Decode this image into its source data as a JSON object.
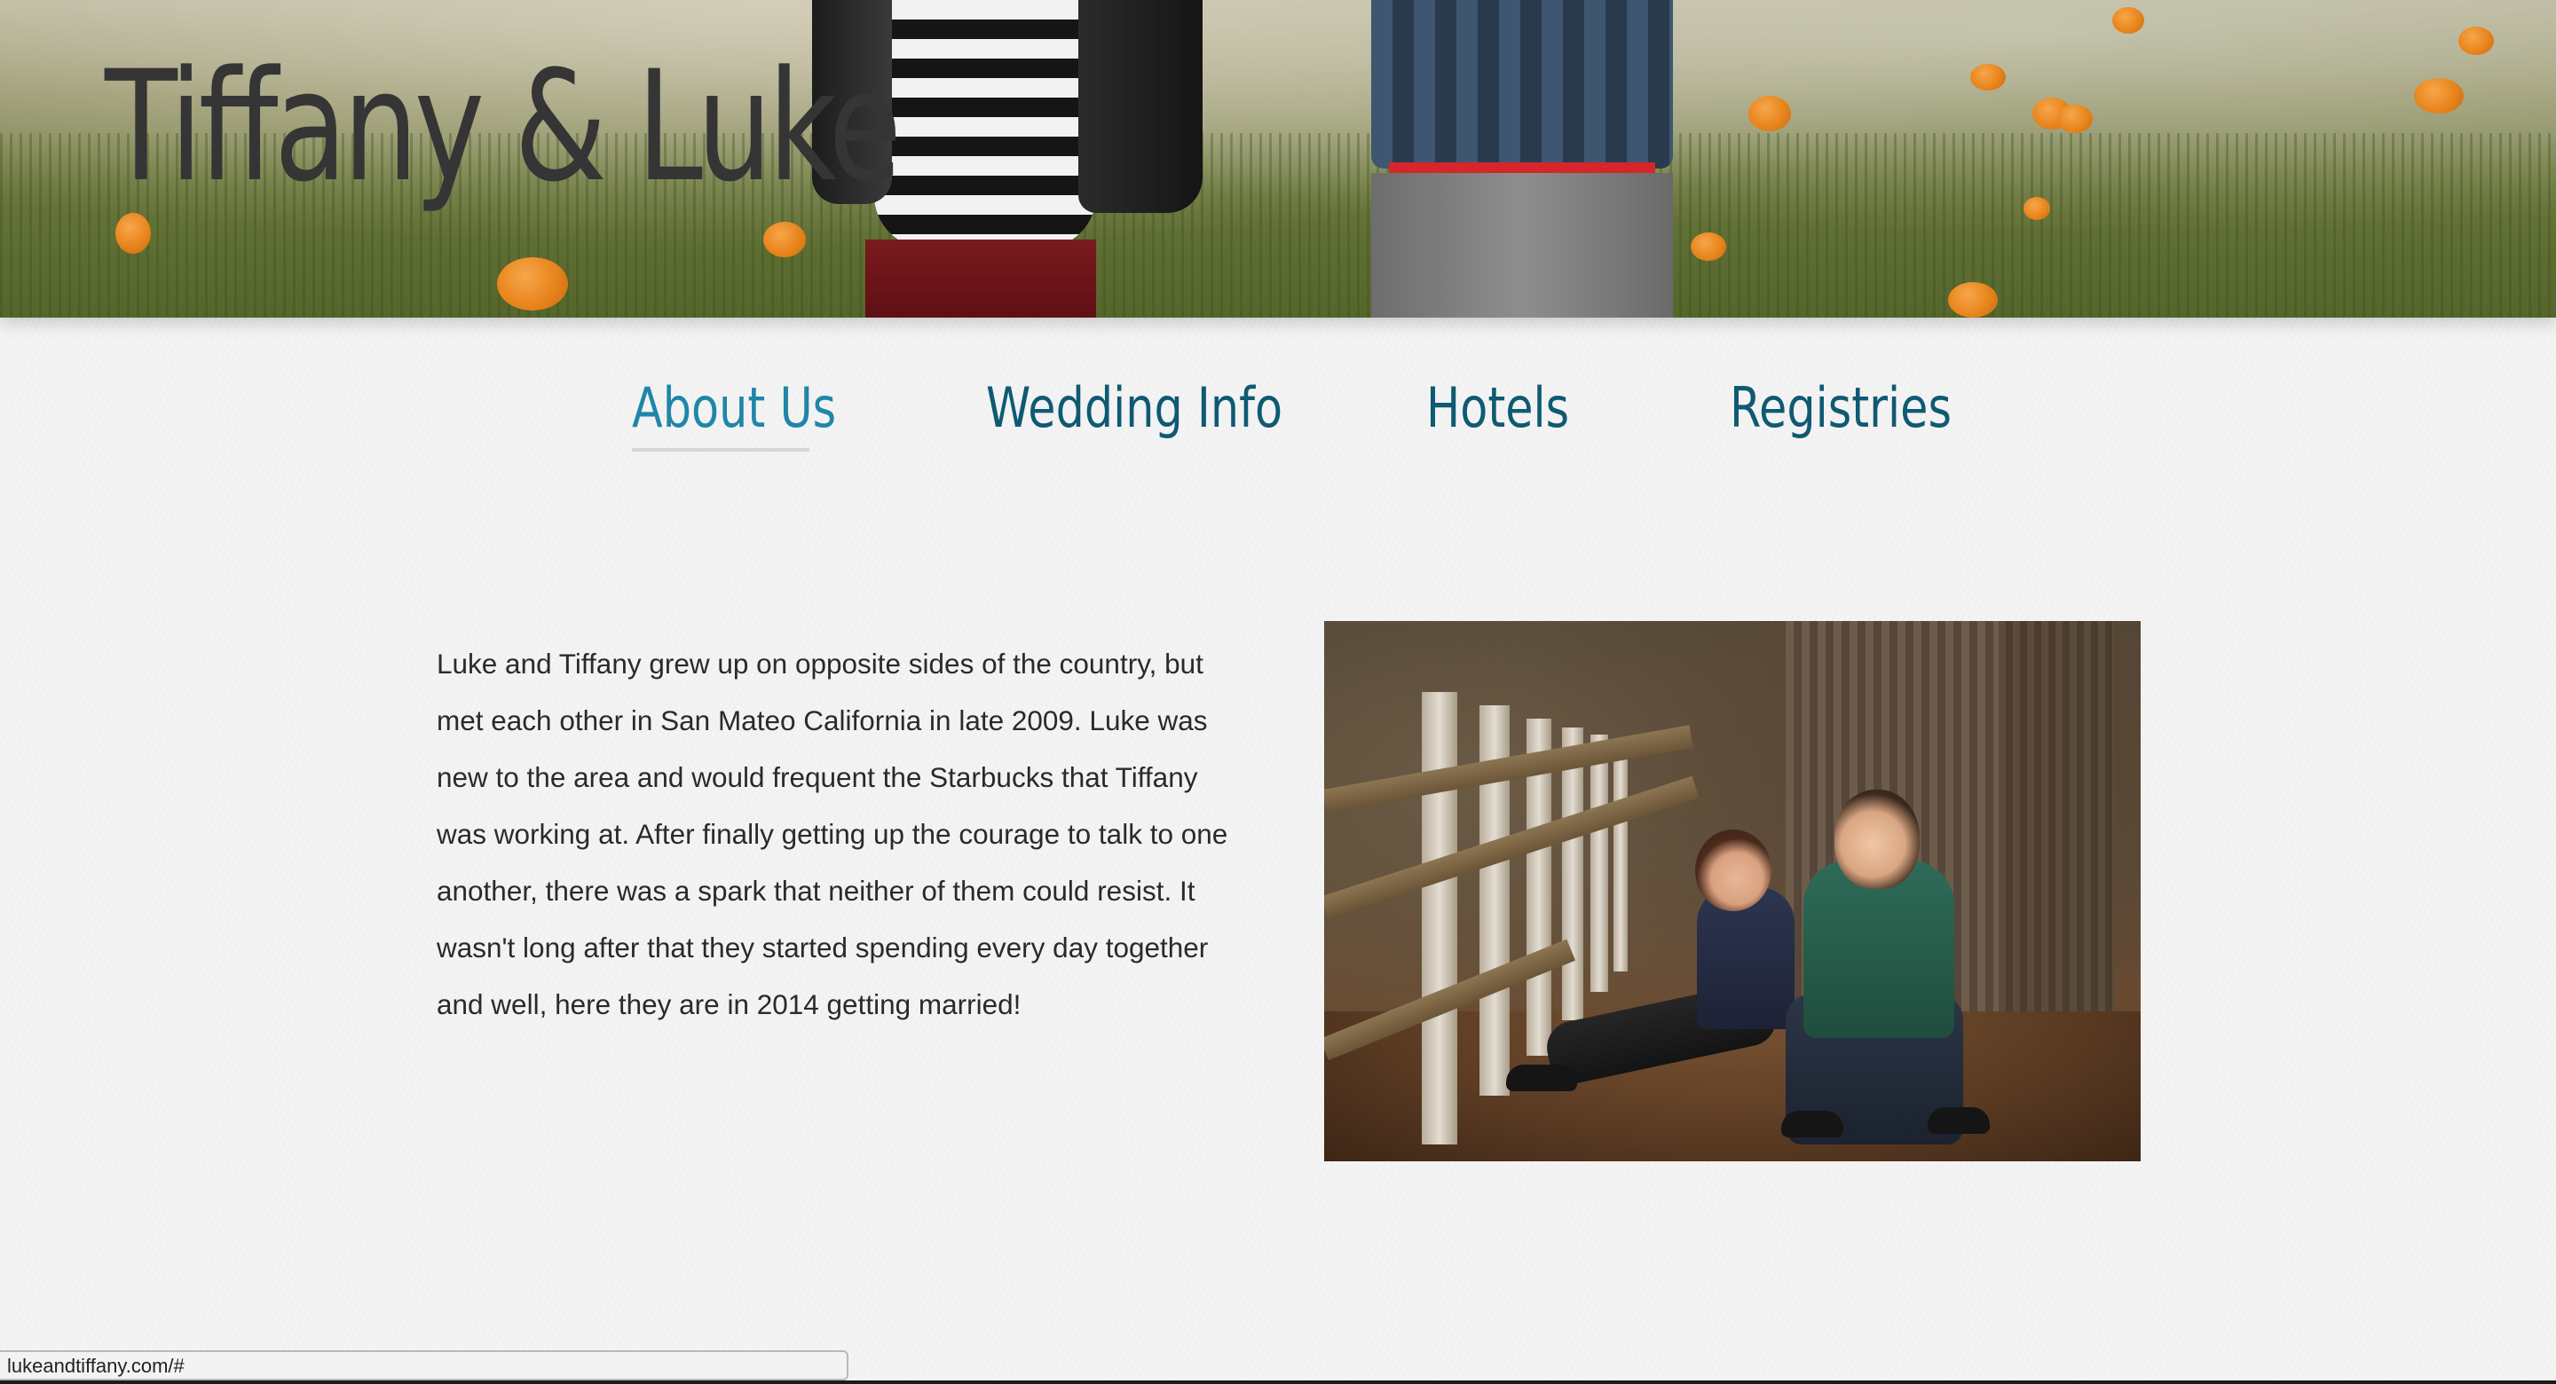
{
  "site": {
    "title": "Tiffany & Luke"
  },
  "nav": {
    "items": [
      {
        "label": "About Us",
        "active": true
      },
      {
        "label": "Wedding Info",
        "active": false
      },
      {
        "label": "Hotels",
        "active": false
      },
      {
        "label": "Registries",
        "active": false
      }
    ],
    "colors": {
      "active": "#1f86a8",
      "default": "#0f5a73"
    }
  },
  "about": {
    "lines": [
      "Luke and Tiffany grew up on opposite sides of the country, but",
      "met each other in San Mateo California in late 2009. Luke was",
      "new to the area and would frequent the Starbucks that Tiffany",
      "was working at. After finally getting up the courage to talk to one",
      "another, there was a spark that neither of them could resist. It",
      "wasn't long after that they started spending every day together",
      "and well, here they are in 2014 getting married!"
    ]
  },
  "status_bar": {
    "url": "lukeandtiffany.com/#"
  }
}
